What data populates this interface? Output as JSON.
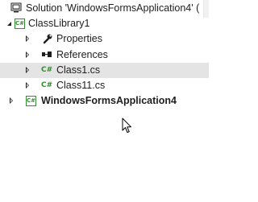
{
  "explorer": {
    "solution": {
      "label": "Solution 'WindowsFormsApplication4' (",
      "icon": "solution-icon"
    },
    "project1": {
      "label": "ClassLibrary1",
      "icon": "csharp-project-icon",
      "expanded": true
    },
    "items": [
      {
        "label": "Properties",
        "icon": "wrench-icon"
      },
      {
        "label": "References",
        "icon": "references-icon"
      },
      {
        "label": "Class1.cs",
        "icon": "csharp-file-icon",
        "selected": true
      },
      {
        "label": "Class11.cs",
        "icon": "csharp-file-icon"
      }
    ],
    "project2": {
      "label": "WindowsFormsApplication4",
      "icon": "csharp-project-icon",
      "bold": true,
      "expanded": false
    },
    "cs_glyph": "C#"
  },
  "colors": {
    "selection": "#e4e4e4",
    "csharp_green": "#388a34"
  }
}
